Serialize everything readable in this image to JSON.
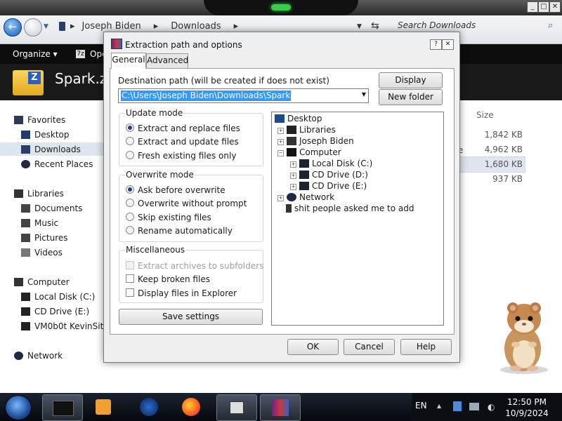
{
  "explorer": {
    "breadcrumb": [
      "Joseph Biden",
      "Downloads"
    ],
    "search_placeholder": "Search Downloads",
    "organize_label": "Organize ▾",
    "open_label": "Ope",
    "folder_name": "Spark.zi",
    "size_header": "Size",
    "nav": {
      "favorites": "Favorites",
      "desktop": "Desktop",
      "downloads": "Downloads",
      "recent": "Recent Places",
      "libraries": "Libraries",
      "documents": "Documents",
      "music": "Music",
      "pictures": "Pictures",
      "videos": "Videos",
      "computer": "Computer",
      "local_disk": "Local Disk (C:)",
      "cd_drive": "CD Drive (E:)",
      "vm_share": "VM0b0t KevinSite",
      "network": "Network"
    },
    "sizes": [
      "1,842 KB",
      "4,962 KB",
      "1,680 KB",
      "937 KB"
    ],
    "partial_type": "e"
  },
  "dialog": {
    "title": "Extraction path and options",
    "tabs": [
      "General",
      "Advanced"
    ],
    "dest_label": "Destination path (will be created if does not exist)",
    "dest_value": "C:\\Users\\Joseph Biden\\Downloads\\Spark",
    "display_btn": "Display",
    "new_folder_btn": "New folder",
    "update_mode": {
      "title": "Update mode",
      "options": [
        "Extract and replace files",
        "Extract and update files",
        "Fresh existing files only"
      ],
      "selected": 0
    },
    "overwrite_mode": {
      "title": "Overwrite mode",
      "options": [
        "Ask before overwrite",
        "Overwrite without prompt",
        "Skip existing files",
        "Rename automatically"
      ],
      "selected": 0
    },
    "misc": {
      "title": "Miscellaneous",
      "options": [
        "Extract archives to subfolders",
        "Keep broken files",
        "Display files in Explorer"
      ]
    },
    "save_btn": "Save settings",
    "tree": [
      "Desktop",
      "Libraries",
      "Joseph Biden",
      "Computer",
      "Local Disk (C:)",
      "CD Drive (D:)",
      "CD Drive (E:)",
      "Network",
      "shit people asked me to add"
    ],
    "ok_btn": "OK",
    "cancel_btn": "Cancel",
    "help_btn": "Help"
  },
  "taskbar": {
    "lang": "EN",
    "time": "12:50 PM",
    "date": "10/9/2024"
  }
}
